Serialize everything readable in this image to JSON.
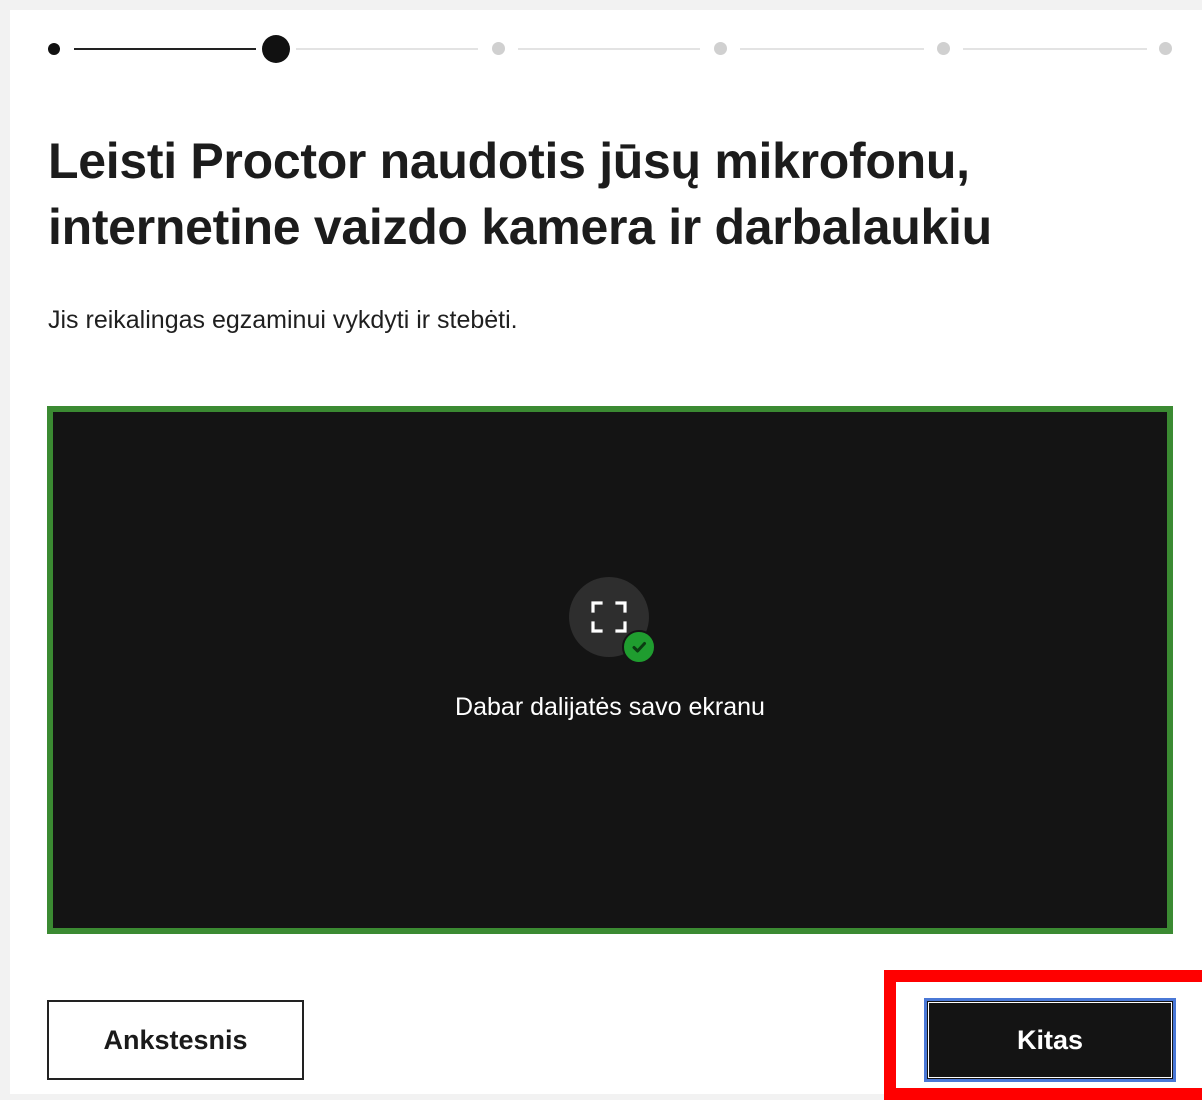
{
  "stepper": {
    "total_steps": 6,
    "current_step": 2,
    "colors": {
      "done": "#111111",
      "pending": "#d0d0d0"
    }
  },
  "header": {
    "title_line1": "Leisti Proctor naudotis jūsų mikrofonu,",
    "title_line2": "internetine vaizdo kamera ir darbalaukiu",
    "subtitle": "Jis reikalingas egzaminui vykdyti ir stebėti."
  },
  "preview": {
    "status_text": "Dabar dalijatės savo ekranu",
    "icon": "screen-share-icon",
    "status_icon": "check-icon",
    "colors": {
      "border": "#3b8a32",
      "background": "#141414",
      "check": "#1f9d2f"
    }
  },
  "footer": {
    "back_label": "Ankstesnis",
    "next_label": "Kitas",
    "highlight_color": "#ff0000"
  }
}
